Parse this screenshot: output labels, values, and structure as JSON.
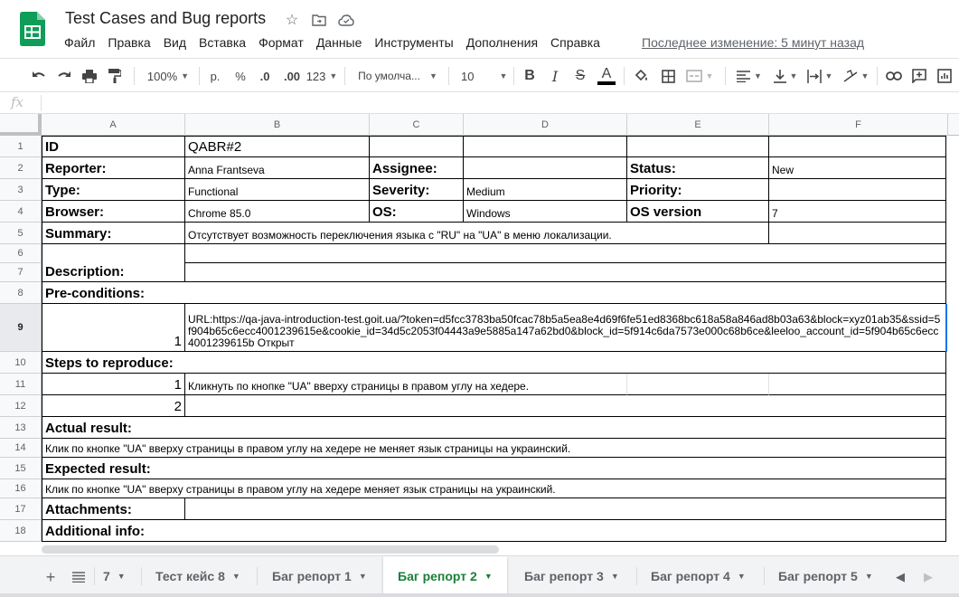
{
  "doc": {
    "title": "Test Cases and Bug reports",
    "last_edit": "Последнее изменение: 5 минут назад"
  },
  "menu": [
    "Файл",
    "Правка",
    "Вид",
    "Вставка",
    "Формат",
    "Данные",
    "Инструменты",
    "Дополнения",
    "Справка"
  ],
  "toolbar": {
    "zoom": "100%",
    "currency": "р.",
    "percent": "%",
    "dec_decrease": ".0",
    "dec_increase": ".00",
    "more_formats": "123",
    "font": "По умолча...",
    "font_size": "10"
  },
  "formula_bar": {
    "fx": "fx",
    "value": ""
  },
  "columns": [
    "A",
    "B",
    "C",
    "D",
    "E",
    "F"
  ],
  "rows": [
    "1",
    "2",
    "3",
    "4",
    "5",
    "6",
    "7",
    "8",
    "9",
    "10",
    "11",
    "12",
    "13",
    "14",
    "15",
    "16",
    "17",
    "18"
  ],
  "cells": {
    "r1": {
      "a": "ID",
      "b": "QABR#2"
    },
    "r2": {
      "a": "Reporter:",
      "b": "Anna Frantseva",
      "c": "Assignee:",
      "e": "Status:",
      "f": "New"
    },
    "r3": {
      "a": "Type:",
      "b": "Functional",
      "c": "Severity:",
      "d": "Medium",
      "e": "Priority:"
    },
    "r4": {
      "a": "Browser:",
      "b": "Chrome 85.0",
      "c": "OS:",
      "d": "Windows",
      "e": "OS version",
      "f": "7"
    },
    "r5": {
      "a": "Summary:",
      "b": "Отсутствует возможность переключения языка с \"RU\" на \"UA\" в меню локализации."
    },
    "r7": {
      "a": "Description:"
    },
    "r8": {
      "a": "Pre-conditions:"
    },
    "r9": {
      "a": "1",
      "b": "URL:https://qa-java-introduction-test.goit.ua/?token=d5fcc3783ba50fcac78b5a5ea8e4d69f6fe51ed8368bc618a58a846ad8b03a63&block=xyz01ab35&ssid=5f904b65c6ecc4001239615e&cookie_id=34d5c2053f04443a9e5885a147a62bd0&block_id=5f914c6da7573e000c68b6ce&leeloo_account_id=5f904b65c6ecc4001239615b Открыт"
    },
    "r10": {
      "a": "Steps to reproduce:"
    },
    "r11": {
      "a": "1",
      "b": "Кликнуть по кнопке \"UA\" вверху страницы в правом углу на хедере."
    },
    "r12": {
      "a": "2"
    },
    "r13": {
      "a": "Actual result:"
    },
    "r14": {
      "a": " Клик по кнопке \"UA\" вверху страницы в правом углу на хедере не меняет язык страницы на украинский."
    },
    "r15": {
      "a": "Expected result:"
    },
    "r16": {
      "a": "Клик по кнопке \"UA\" вверху страницы в правом углу на хедере меняет язык страницы на украинский."
    },
    "r17": {
      "a": "Attachments:"
    },
    "r18": {
      "a": "Additional info:"
    }
  },
  "sheets": [
    {
      "label": "7"
    },
    {
      "label": "Тест кейс 8"
    },
    {
      "label": "Баг репорт 1"
    },
    {
      "label": "Баг репорт 2",
      "active": true
    },
    {
      "label": "Баг репорт 3"
    },
    {
      "label": "Баг репорт 4"
    },
    {
      "label": "Баг репорт 5"
    }
  ],
  "colors": {
    "accent": "#188038",
    "selection": "#1a73e8",
    "sheets_green": "#0f9d58"
  }
}
